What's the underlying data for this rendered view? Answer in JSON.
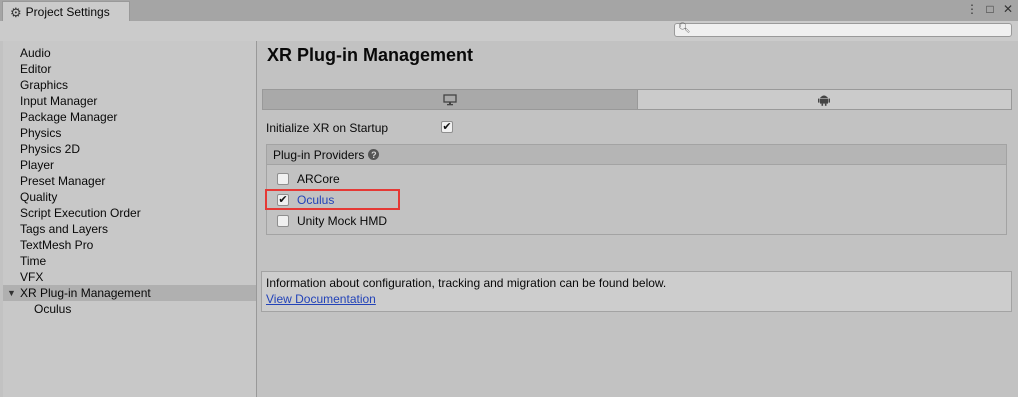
{
  "window": {
    "tab_title": "Project Settings",
    "icons": [
      "gear-icon",
      "kebab-menu-icon",
      "maximize-icon",
      "close-icon"
    ]
  },
  "search": {
    "placeholder": "",
    "value": ""
  },
  "sidebar": {
    "items": [
      {
        "label": "Audio"
      },
      {
        "label": "Editor"
      },
      {
        "label": "Graphics"
      },
      {
        "label": "Input Manager"
      },
      {
        "label": "Package Manager"
      },
      {
        "label": "Physics"
      },
      {
        "label": "Physics 2D"
      },
      {
        "label": "Player"
      },
      {
        "label": "Preset Manager"
      },
      {
        "label": "Quality"
      },
      {
        "label": "Script Execution Order"
      },
      {
        "label": "Tags and Layers"
      },
      {
        "label": "TextMesh Pro"
      },
      {
        "label": "Time"
      },
      {
        "label": "VFX"
      },
      {
        "label": "XR Plug-in Management",
        "selected": true,
        "expanded": true
      },
      {
        "label": "Oculus",
        "child": true
      }
    ]
  },
  "main": {
    "title": "XR Plug-in Management",
    "platform_tabs": [
      {
        "icon": "desktop-monitor-icon",
        "active": false
      },
      {
        "icon": "android-icon",
        "active": true
      }
    ],
    "init_label": "Initialize XR on Startup",
    "init_checked": true,
    "providers_header": "Plug-in Providers",
    "providers": [
      {
        "label": "ARCore",
        "checked": false
      },
      {
        "label": "Oculus",
        "checked": true,
        "highlighted": true
      },
      {
        "label": "Unity Mock HMD",
        "checked": false
      }
    ],
    "info_text": "Information about configuration, tracking and migration can be found below.",
    "doc_link": "View Documentation"
  },
  "colors": {
    "background": "#c2c2c2",
    "selected_row": "#b0b0b0",
    "link": "#2343b8",
    "highlight_border": "#e53935"
  }
}
